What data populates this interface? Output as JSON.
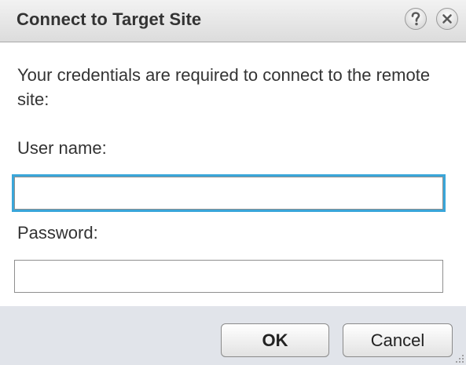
{
  "dialog": {
    "title": "Connect to Target Site",
    "help_icon": "question-mark-icon",
    "close_icon": "close-x-icon",
    "message": "Your credentials are required to connect to the remote site:"
  },
  "form": {
    "username_label": "User name:",
    "username_value": "",
    "password_label": "Password:",
    "password_value": ""
  },
  "buttons": {
    "ok_label": "OK",
    "cancel_label": "Cancel"
  },
  "colors": {
    "focus_ring": "#3aa6d9",
    "footer_bg": "#e1e4ea",
    "title_text": "#333333"
  }
}
